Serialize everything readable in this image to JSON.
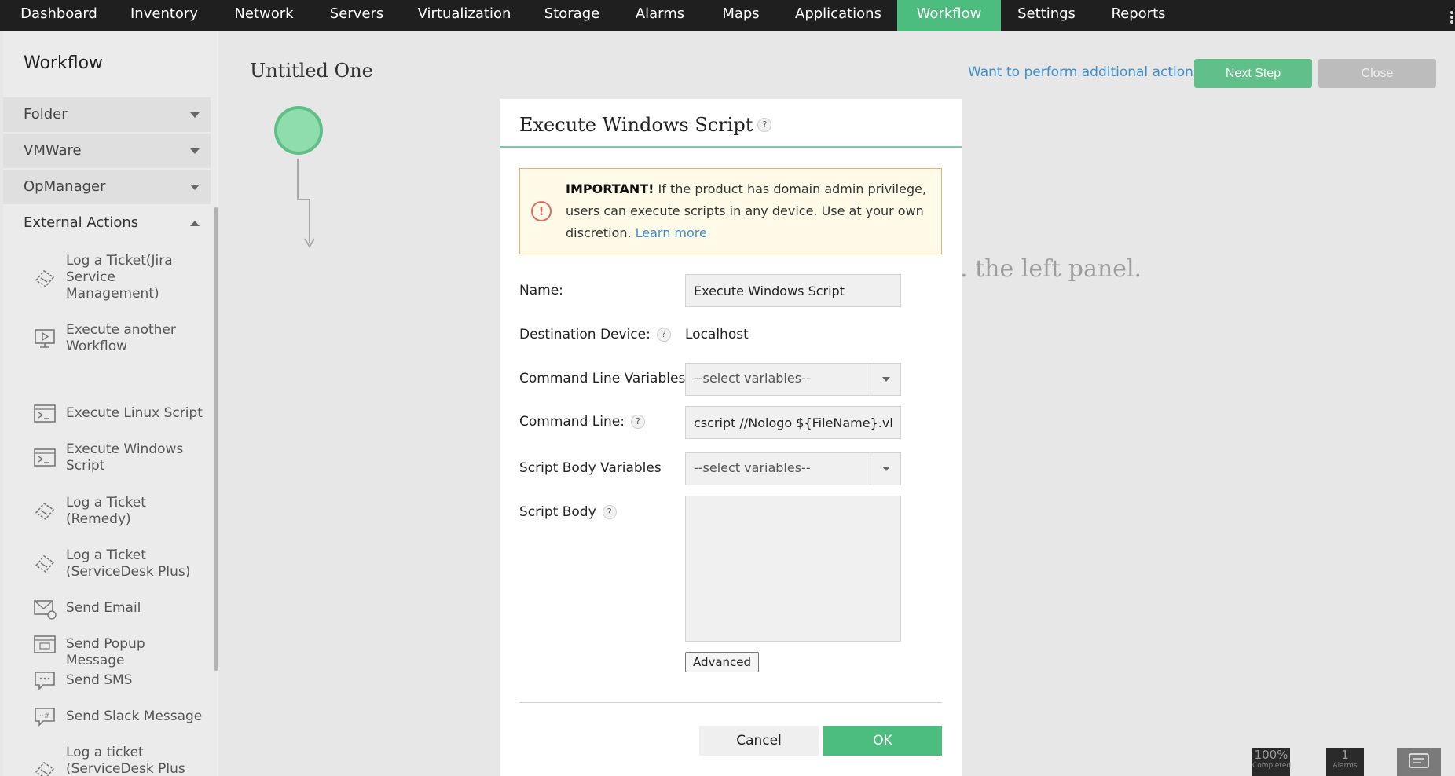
{
  "nav": {
    "items": [
      "Dashboard",
      "Inventory",
      "Network",
      "Servers",
      "Virtualization",
      "Storage",
      "Alarms",
      "Maps",
      "Applications",
      "Workflow",
      "Settings",
      "Reports"
    ],
    "active": "Workflow"
  },
  "sidebar": {
    "title": "Workflow",
    "sections": [
      "Folder",
      "VMWare",
      "OpManager",
      "External Actions"
    ],
    "items": [
      {
        "label": "Log a Ticket(Jira Service Management)",
        "icon": "ticket-icon"
      },
      {
        "label": "Execute another Workflow",
        "icon": "play-monitor-icon"
      },
      {
        "label": "Execute Linux Script",
        "icon": "terminal-icon"
      },
      {
        "label": "Execute Windows Script",
        "icon": "terminal-icon"
      },
      {
        "label": "Log a Ticket (Remedy)",
        "icon": "ticket-icon"
      },
      {
        "label": "Log a Ticket (ServiceDesk Plus)",
        "icon": "ticket-icon"
      },
      {
        "label": "Send Email",
        "icon": "email-icon"
      },
      {
        "label": "Send Popup Message",
        "icon": "popup-window-icon"
      },
      {
        "label": "Send SMS",
        "icon": "sms-icon"
      },
      {
        "label": "Send Slack Message",
        "icon": "slack-message-icon"
      },
      {
        "label": "Log a ticket (ServiceDesk Plus Cloud)",
        "icon": "ticket-icon"
      }
    ]
  },
  "canvas": {
    "workflow_name": "Untitled One",
    "additional_link": "Want to perform additional actions?",
    "next_step": "Next Step",
    "close": "Close",
    "hint_fragment": ". the left panel."
  },
  "status": {
    "completed_value": "100%",
    "completed_label": "Completed",
    "alarms_value": "1",
    "alarms_label": "Alarms"
  },
  "dialog": {
    "title": "Execute Windows Script",
    "help": "?",
    "warning": {
      "strong": "IMPORTANT!",
      "text": " If the product has domain admin privilege, users can execute scripts in any device. Use at your own discretion. ",
      "link": "Learn more"
    },
    "fields": {
      "name_label": "Name:",
      "name_value": "Execute Windows Script",
      "dest_label": "Destination Device:",
      "dest_value": "Localhost",
      "cmdvars_label": "Command Line Variables",
      "cmdvars_value": "--select variables--",
      "cmdline_label": "Command Line:",
      "cmdline_value": "cscript //Nologo ${FileName}.vbs",
      "bodyvars_label": "Script Body Variables",
      "bodyvars_value": "--select variables--",
      "body_label": "Script Body"
    },
    "advanced": "Advanced",
    "cancel": "Cancel",
    "ok": "OK"
  },
  "colors": {
    "accent": "#4dbd7f",
    "nav_bg": "#1f1f1f",
    "link": "#3b8fcf"
  }
}
